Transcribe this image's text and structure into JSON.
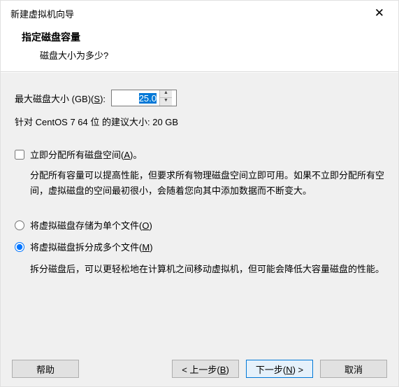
{
  "titlebar": {
    "title": "新建虚拟机向导"
  },
  "header": {
    "main": "指定磁盘容量",
    "sub": "磁盘大小为多少?"
  },
  "disk": {
    "size_label_pre": "最大磁盘大小 (GB)(",
    "size_label_key": "S",
    "size_label_post": "):",
    "size_value": "25.0",
    "suggestion": "针对 CentOS 7 64 位 的建议大小: 20 GB"
  },
  "allocate": {
    "label_pre": "立即分配所有磁盘空间(",
    "label_key": "A",
    "label_post": ")。",
    "desc": "分配所有容量可以提高性能，但要求所有物理磁盘空间立即可用。如果不立即分配所有空间，虚拟磁盘的空间最初很小，会随着您向其中添加数据而不断变大。"
  },
  "split": {
    "single_pre": "将虚拟磁盘存储为单个文件(",
    "single_key": "O",
    "single_post": ")",
    "multi_pre": "将虚拟磁盘拆分成多个文件(",
    "multi_key": "M",
    "multi_post": ")",
    "multi_desc": "拆分磁盘后，可以更轻松地在计算机之间移动虚拟机，但可能会降低大容量磁盘的性能。"
  },
  "footer": {
    "help": "帮助",
    "back_pre": "< 上一步(",
    "back_key": "B",
    "back_post": ")",
    "next_pre": "下一步(",
    "next_key": "N",
    "next_post": ") >",
    "cancel": "取消"
  }
}
